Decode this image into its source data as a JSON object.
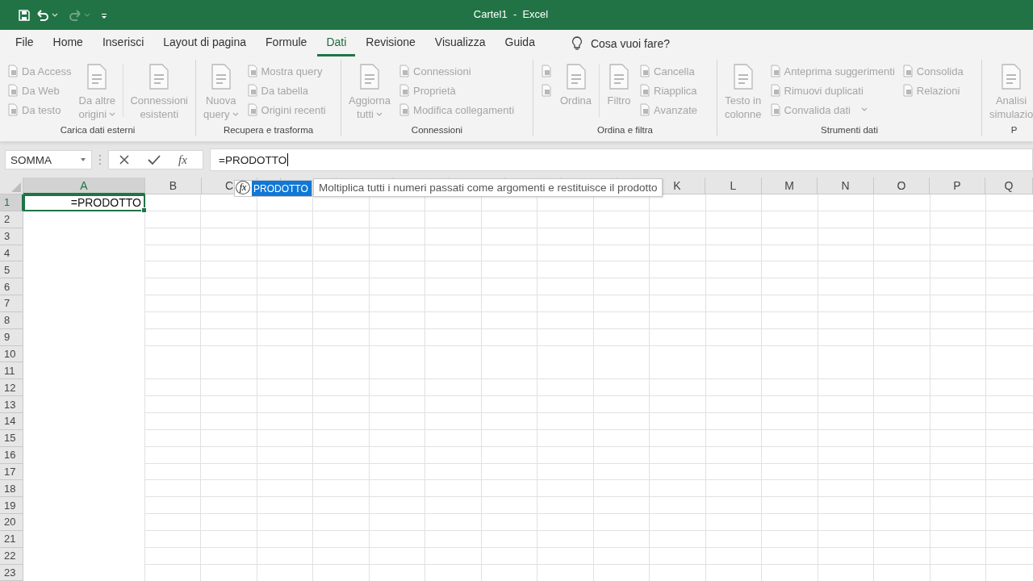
{
  "window": {
    "title": "Cartel1  -  Excel"
  },
  "quick_access": {
    "redo_disabled": true
  },
  "tabs": [
    {
      "label": "File",
      "selected": false
    },
    {
      "label": "Home",
      "selected": false
    },
    {
      "label": "Inserisci",
      "selected": false
    },
    {
      "label": "Layout di pagina",
      "selected": false
    },
    {
      "label": "Formule",
      "selected": false
    },
    {
      "label": "Dati",
      "selected": true
    },
    {
      "label": "Revisione",
      "selected": false
    },
    {
      "label": "Visualizza",
      "selected": false
    },
    {
      "label": "Guida",
      "selected": false
    }
  ],
  "tell_me": {
    "placeholder": "Cosa vuoi fare?"
  },
  "ribbon_groups": [
    {
      "label": "Carica dati esterni",
      "columns": [
        {
          "kind": "stack",
          "items": [
            {
              "label": "Da Access",
              "disabled": true
            },
            {
              "label": "Da Web",
              "disabled": true
            },
            {
              "label": "Da testo",
              "disabled": true
            }
          ]
        },
        {
          "kind": "large",
          "lines": [
            "Da altre",
            "origini"
          ],
          "dropdown": true,
          "disabled": true
        },
        {
          "kind": "separator"
        },
        {
          "kind": "large",
          "lines": [
            "Connessioni",
            "esistenti"
          ],
          "dropdown": false,
          "disabled": true
        }
      ]
    },
    {
      "label": "Recupera e trasforma",
      "columns": [
        {
          "kind": "large",
          "lines": [
            "Nuova",
            "query"
          ],
          "dropdown": true,
          "disabled": true
        },
        {
          "kind": "stack",
          "items": [
            {
              "label": "Mostra query",
              "disabled": true
            },
            {
              "label": "Da tabella",
              "disabled": true
            },
            {
              "label": "Origini recenti",
              "disabled": true
            }
          ]
        }
      ]
    },
    {
      "label": "Connessioni",
      "columns": [
        {
          "kind": "large",
          "lines": [
            "Aggiorna",
            "tutti"
          ],
          "dropdown": true,
          "disabled": true
        },
        {
          "kind": "stack",
          "items": [
            {
              "label": "Connessioni",
              "disabled": true
            },
            {
              "label": "Proprietà",
              "disabled": true
            },
            {
              "label": "Modifica collegamenti",
              "disabled": true
            }
          ]
        }
      ]
    },
    {
      "label": "Ordina e filtra",
      "columns": [
        {
          "kind": "stack",
          "items": [
            {
              "disabled": true
            },
            {
              "disabled": true
            }
          ]
        },
        {
          "kind": "large",
          "lines": [
            "Ordina"
          ],
          "dropdown": false,
          "disabled": true
        },
        {
          "kind": "separator"
        },
        {
          "kind": "large",
          "lines": [
            "Filtro"
          ],
          "dropdown": false,
          "disabled": true
        },
        {
          "kind": "stack",
          "items": [
            {
              "label": "Cancella",
              "disabled": true
            },
            {
              "label": "Riapplica",
              "disabled": true
            },
            {
              "label": "Avanzate",
              "disabled": true
            }
          ]
        }
      ]
    },
    {
      "label": "Strumenti dati",
      "columns": [
        {
          "kind": "large",
          "lines": [
            "Testo in",
            "colonne"
          ],
          "dropdown": false,
          "disabled": true
        },
        {
          "kind": "stack",
          "items": [
            {
              "label": "Anteprima suggerimenti",
              "disabled": true
            },
            {
              "label": "Rimuovi duplicati",
              "disabled": true
            },
            {
              "label": "Convalida dati",
              "disabled": true,
              "dropdown": true
            }
          ]
        },
        {
          "kind": "stack",
          "items": [
            {
              "label": "Consolida",
              "disabled": true
            },
            {
              "label": "Relazioni",
              "disabled": true
            }
          ]
        }
      ]
    },
    {
      "label": "P",
      "columns": [
        {
          "kind": "large",
          "lines": [
            "Analisi",
            "simulazio"
          ],
          "dropdown": false,
          "disabled": true
        }
      ]
    }
  ],
  "formula_bar": {
    "name_box": "SOMMA",
    "insert_function": "fx",
    "value": "=PRODOTTO"
  },
  "columns": [
    {
      "label": "A",
      "selected": true
    },
    {
      "label": "B",
      "selected": false
    },
    {
      "label": "C",
      "selected": false
    },
    {
      "label": "K",
      "selected": false
    },
    {
      "label": "L",
      "selected": false
    },
    {
      "label": "M",
      "selected": false
    },
    {
      "label": "N",
      "selected": false
    },
    {
      "label": "O",
      "selected": false
    },
    {
      "label": "P",
      "selected": false
    },
    {
      "label": "Q",
      "selected": false
    }
  ],
  "rows": [
    {
      "label": "1",
      "selected": true,
      "cells": [
        {
          "value": "=PRODOTTO",
          "active": true
        }
      ]
    },
    {
      "label": "2",
      "selected": false
    },
    {
      "label": "3",
      "selected": false
    },
    {
      "label": "4",
      "selected": false
    },
    {
      "label": "5",
      "selected": false
    },
    {
      "label": "6",
      "selected": false
    },
    {
      "label": "7",
      "selected": false
    },
    {
      "label": "8",
      "selected": false
    },
    {
      "label": "9",
      "selected": false
    },
    {
      "label": "10",
      "selected": false
    },
    {
      "label": "11",
      "selected": false
    },
    {
      "label": "12",
      "selected": false
    },
    {
      "label": "13",
      "selected": false
    },
    {
      "label": "14",
      "selected": false
    },
    {
      "label": "15",
      "selected": false
    },
    {
      "label": "16",
      "selected": false
    },
    {
      "label": "17",
      "selected": false
    },
    {
      "label": "18",
      "selected": false
    },
    {
      "label": "19",
      "selected": false
    },
    {
      "label": "20",
      "selected": false
    },
    {
      "label": "21",
      "selected": false
    },
    {
      "label": "22",
      "selected": false
    },
    {
      "label": "23",
      "selected": false
    }
  ],
  "autocomplete": {
    "icon_text": "fx",
    "items": [
      {
        "label": "PRODOTTO",
        "selected": true
      }
    ]
  },
  "tooltip": {
    "text": "Moltiplica tutti i numeri passati come argomenti e restituisce il prodotto"
  }
}
